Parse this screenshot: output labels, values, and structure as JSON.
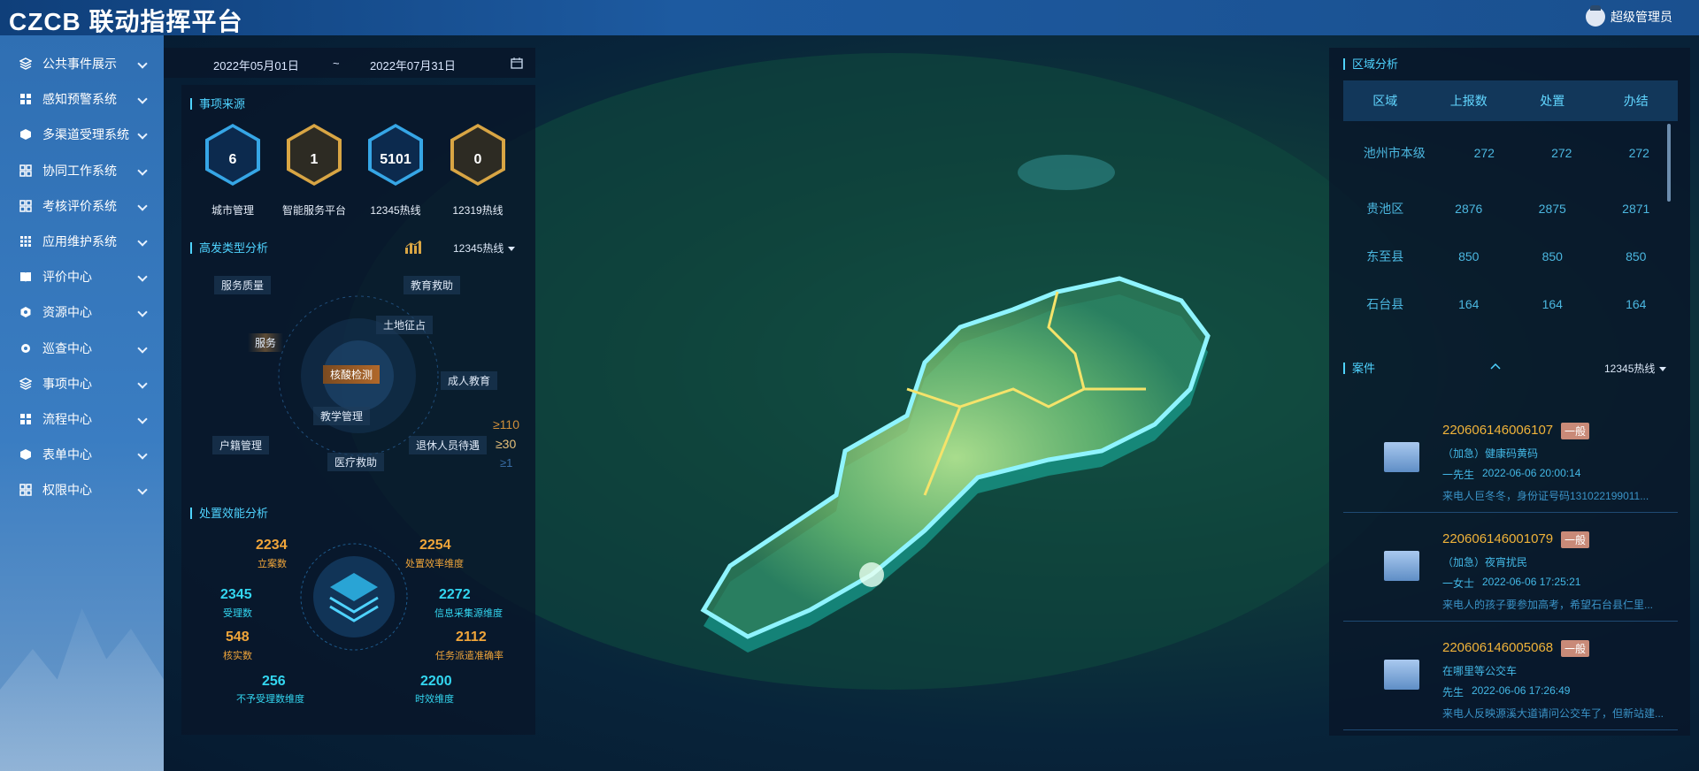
{
  "app": {
    "brand": "CZCB 联动指挥平台",
    "user": "超级管理员"
  },
  "sidebar": {
    "items": [
      {
        "label": "公共事件展示",
        "icon": "layers-icon"
      },
      {
        "label": "感知预警系统",
        "icon": "grid-icon"
      },
      {
        "label": "多渠道受理系统",
        "icon": "cube-icon"
      },
      {
        "label": "协同工作系统",
        "icon": "apps-icon"
      },
      {
        "label": "考核评价系统",
        "icon": "apps-icon"
      },
      {
        "label": "应用维护系统",
        "icon": "dots-grid-icon"
      },
      {
        "label": "评价中心",
        "icon": "book-icon"
      },
      {
        "label": "资源中心",
        "icon": "hexagon-gear-icon"
      },
      {
        "label": "巡查中心",
        "icon": "gear-icon"
      },
      {
        "label": "事项中心",
        "icon": "layers-icon"
      },
      {
        "label": "流程中心",
        "icon": "grid-icon"
      },
      {
        "label": "表单中心",
        "icon": "cube-icon"
      },
      {
        "label": "权限中心",
        "icon": "apps-icon"
      }
    ]
  },
  "date_range": {
    "start": "2022年05月01日",
    "sep": "~",
    "end": "2022年07月31日"
  },
  "source": {
    "title": "事项来源",
    "items": [
      {
        "value": "6",
        "label": "城市管理",
        "style": "blue"
      },
      {
        "value": "1",
        "label": "智能服务平台",
        "style": "gold"
      },
      {
        "value": "5101",
        "label": "12345热线",
        "style": "blue"
      },
      {
        "value": "0",
        "label": "12319热线",
        "style": "gold"
      }
    ]
  },
  "hotspot": {
    "title": "高发类型分析",
    "filter": "12345热线",
    "tags": [
      "服务质量",
      "教育救助",
      "土地征占",
      "服务",
      "核酸检测",
      "成人教育",
      "教学管理",
      "户籍管理",
      "退休人员待遇",
      "医疗救助"
    ],
    "legend": [
      "≥110",
      "≥30",
      "≥1"
    ]
  },
  "efficiency": {
    "title": "处置效能分析",
    "stats": [
      {
        "value": "2234",
        "label": "立案数"
      },
      {
        "value": "2254",
        "label": "处置效率维度"
      },
      {
        "value": "2345",
        "label": "受理数"
      },
      {
        "value": "2272",
        "label": "信息采集源维度"
      },
      {
        "value": "548",
        "label": "核实数"
      },
      {
        "value": "2112",
        "label": "任务派遣准确率"
      },
      {
        "value": "256",
        "label": "不予受理数维度"
      },
      {
        "value": "2200",
        "label": "时效维度"
      }
    ]
  },
  "region": {
    "title": "区域分析",
    "columns": [
      "区域",
      "上报数",
      "处置",
      "办结"
    ],
    "rows": [
      {
        "name": "池州市本级",
        "reported": "272",
        "handled": "272",
        "closed": "272"
      },
      {
        "name": "贵池区",
        "reported": "2876",
        "handled": "2875",
        "closed": "2871"
      },
      {
        "name": "东至县",
        "reported": "850",
        "handled": "850",
        "closed": "850"
      },
      {
        "name": "石台县",
        "reported": "164",
        "handled": "164",
        "closed": "164"
      }
    ]
  },
  "cases": {
    "title": "案件",
    "filter": "12345热线",
    "items": [
      {
        "id": "220606146006107",
        "level": "一般",
        "title": "（加急）健康码黄码",
        "person": "一先生",
        "time": "2022-06-06 20:00:14",
        "desc": "来电人巨冬冬，身份证号码131022199011..."
      },
      {
        "id": "220606146001079",
        "level": "一般",
        "title": "（加急）夜宵扰民",
        "person": "一女士",
        "time": "2022-06-06 17:25:21",
        "desc": "来电人的孩子要参加高考，希望石台县仁里..."
      },
      {
        "id": "220606146005068",
        "level": "一般",
        "title": "在哪里等公交车",
        "person": "先生",
        "time": "2022-06-06 17:26:49",
        "desc": "来电人反映源溪大道请问公交车了，但新站建..."
      }
    ]
  }
}
